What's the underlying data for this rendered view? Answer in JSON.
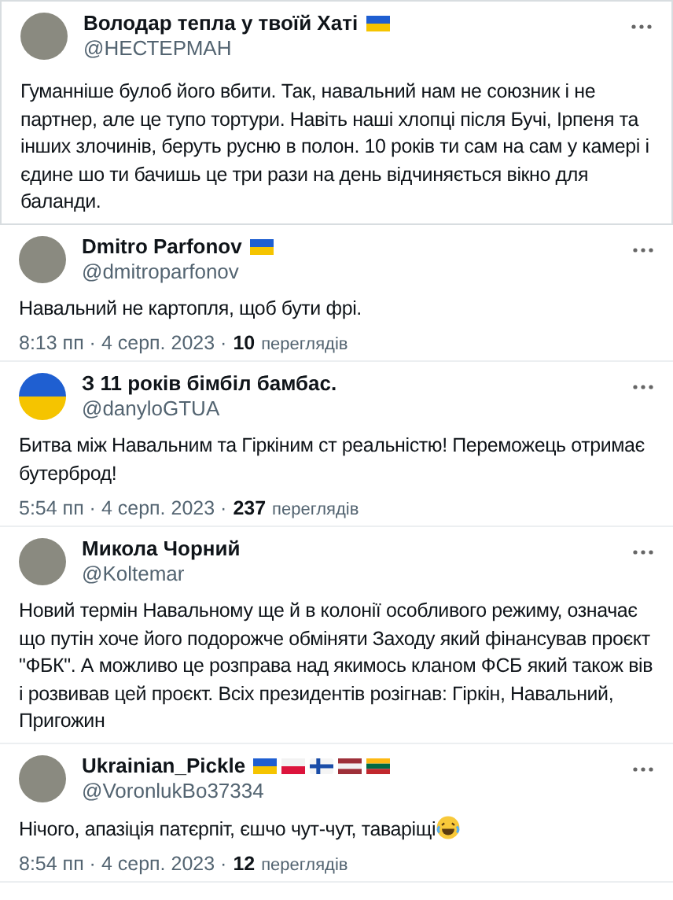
{
  "tweets": [
    {
      "name": "Володар тепла у твоїй Хаті",
      "handle": "@НЕСТЕРМАН",
      "avatar": {
        "kind": "photo"
      },
      "flags": [
        {
          "kind": "ua"
        }
      ],
      "text": "Гуманніше булоб його вбити. Так, навальний нам не союзник і не партнер, але це тупо тортури. Навіть наші хлопці після Бучі, Ірпеня та інших злочинів, беруть русню в полон. 10 років ти сам на сам у камері і єдине шо ти бачишь це три рази на день відчиняється вікно для баланди."
    },
    {
      "name": "Dmitro Parfonov",
      "handle": "@dmitroparfonov",
      "avatar": {
        "kind": "photo"
      },
      "flags": [
        {
          "kind": "ua"
        }
      ],
      "text": "Навальний не картопля, щоб бути фрі.",
      "meta": {
        "date": "8:13 пп · 4 серп. 2023 ·",
        "views": "10",
        "views_label": "переглядів"
      }
    },
    {
      "name": "З 11 років бімбіл бамбас.",
      "handle": "@danyloGTUA",
      "avatar": {
        "kind": "flag"
      },
      "text": "Битва між Навальним та Гіркіним ст реальністю! Переможець отримає бутерброд!",
      "meta": {
        "date": "5:54 пп · 4 серп. 2023 ·",
        "views": "237",
        "views_label": "переглядів"
      }
    },
    {
      "name": "Микола Чорний",
      "handle": "@Koltemar",
      "avatar": {
        "kind": "photo"
      },
      "text": "Новий термін Навальному ще й в колонії особливого режиму, означає що путін хоче його подорожче обміняти Заходу який фінансував проєкт \"ФБК\". А можливо це розправа над якимось кланом ФСБ який також вів і розвивав цей проєкт. Всіх президентів розігнав: Гіркін, Навальний, Пригожин"
    },
    {
      "name": "Ukrainian_Pickle",
      "handle": "@VoronlukBo37334",
      "avatar": {
        "kind": "photo"
      },
      "flags": [
        {
          "kind": "ua"
        },
        {
          "kind": "pl"
        },
        {
          "kind": "fi"
        },
        {
          "kind": "lv"
        },
        {
          "kind": "lt"
        }
      ],
      "text": "Нічого, апазіція патєрпіт, єшчо чут-чут, таваріщі",
      "emoji": {
        "kind": "laugh"
      },
      "meta": {
        "date": "8:54 пп · 4 серп. 2023 ·",
        "views": "12",
        "views_label": "переглядів"
      }
    }
  ]
}
